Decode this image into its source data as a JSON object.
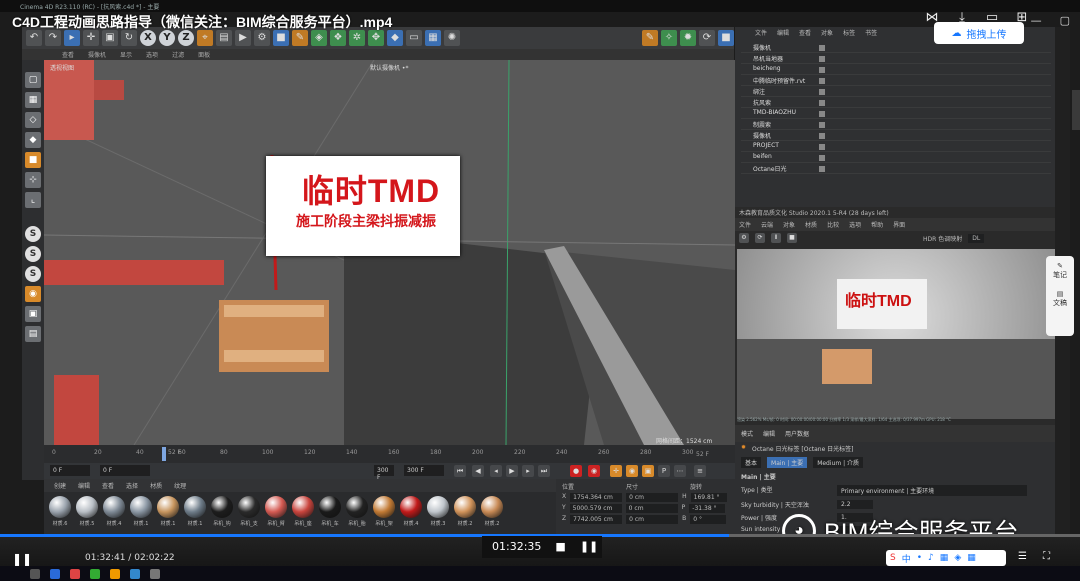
{
  "window": {
    "title": "Cinema 4D R23.110 (RC) - [抗风索.c4d *] - 主要"
  },
  "video": {
    "title": "C4D工程动画思路指导（微信关注：BIM综合服务平台）.mp4",
    "elapsed": "01:32:41",
    "total": "02:02:22",
    "time_sep": "/",
    "pause_time": "01:32:35",
    "progress": 0.675
  },
  "header_actions": {
    "upload_label": "拖拽上传"
  },
  "toolbar": {
    "axis_x": "X",
    "axis_y": "Y",
    "axis_z": "Z"
  },
  "viewport_menu": [
    "查看",
    "摄像机",
    "显示",
    "选项",
    "过滤",
    "面板"
  ],
  "viewport": {
    "label": "透视视图",
    "camera": "默认摄像机 •*",
    "grid_info": "网格间距：1524 cm"
  },
  "scene": {
    "sign_title": "临时TMD",
    "sign_subtitle": "施工阶段主梁抖振减振"
  },
  "timeline": {
    "ticks": [
      "0",
      "20",
      "40",
      "60",
      "80",
      "100",
      "120",
      "140",
      "160",
      "180",
      "200",
      "220",
      "240",
      "260",
      "280",
      "300"
    ],
    "marker": "52 F",
    "end": "52 F"
  },
  "playback": {
    "start": "0 F",
    "current": "0 F",
    "end1": "300 F",
    "end2": "300 F"
  },
  "material_menu": [
    "创建",
    "编辑",
    "查看",
    "选择",
    "材质",
    "纹理"
  ],
  "materials": [
    {
      "label": "材质.6",
      "color": "#9aa3ad"
    },
    {
      "label": "材质.5",
      "color": "#b8bec5"
    },
    {
      "label": "材质.4",
      "color": "#7f8a96"
    },
    {
      "label": "材质.1",
      "color": "#8a96a3"
    },
    {
      "label": "材质.1",
      "color": "#c7955e"
    },
    {
      "label": "材质.1",
      "color": "#6e7c89"
    },
    {
      "label": "吊机_钩",
      "color": "#1d1d1d"
    },
    {
      "label": "吊机_支",
      "color": "#2a2a2a"
    },
    {
      "label": "吊机_臂",
      "color": "#d45a52"
    },
    {
      "label": "吊机_座",
      "color": "#c9443d"
    },
    {
      "label": "吊机_车",
      "color": "#1a1a1a"
    },
    {
      "label": "吊机_胎",
      "color": "#222"
    },
    {
      "label": "吊机_架",
      "color": "#c27a34"
    },
    {
      "label": "材质.4",
      "color": "#c11a1a"
    },
    {
      "label": "材质.3",
      "color": "#bfc5cb"
    },
    {
      "label": "材质.2",
      "color": "#d1935a"
    },
    {
      "label": "材质.2",
      "color": "#c88a55"
    }
  ],
  "coords": {
    "headers": [
      "位置",
      "尺寸",
      "旋转"
    ],
    "rows": [
      {
        "axis": "X",
        "pos": "1754.364 cm",
        "size": "0 cm",
        "rot_l": "H",
        "rot": "169.81 °"
      },
      {
        "axis": "Y",
        "pos": "5000.579 cm",
        "size": "0 cm",
        "rot_l": "P",
        "rot": "-31.38 °"
      },
      {
        "axis": "Z",
        "pos": "7742.005 cm",
        "size": "0 cm",
        "rot_l": "B",
        "rot": "0 °"
      }
    ]
  },
  "object_menu": [
    "文件",
    "编辑",
    "查看",
    "对象",
    "标签",
    "书签"
  ],
  "objects": [
    "摄像机",
    "吊机当地器",
    "beicheng",
    "中腾临时预留件.rvt",
    "绑注",
    "抗风索",
    "TMD-BIAOZHU",
    "制震索",
    "摄像机",
    "PROJECT",
    "beifen",
    "Octane日光"
  ],
  "render": {
    "title": "木森教育品质文化 Studio 2020.1 5-R4 (28 days left)",
    "menu": [
      "文件",
      "云端",
      "对象",
      "材质",
      "比较",
      "选项",
      "帮助",
      "界面"
    ],
    "hdr": "HDR 色调映射",
    "dl": "DL",
    "sign_text": "临时TMD",
    "status": "渲染 2.562%   Ms/帧: 0   时间: 00:00:00/00:00:00   分辨率 1/3   采样/最大采样: 1/64   主选项: 0/37.997m   GPU: 218 °C"
  },
  "attr": {
    "menu": [
      "模式",
      "编辑",
      "用户数据"
    ],
    "object": "Octane 日光标签 [Octane 日光标签]",
    "tabs": [
      "基本",
      "Main | 主要",
      "Medium | 介质"
    ],
    "section": "Main | 主要",
    "rows": [
      {
        "label": "Type | 类型",
        "value": "Primary environment | 主要环境"
      },
      {
        "label": "Sky turbidity | 天空浑浊",
        "value": "2.2"
      },
      {
        "label": "Power | 强度",
        "value": "1."
      },
      {
        "label": "Sun intensity",
        "value": ""
      }
    ]
  },
  "sidetool": {
    "note": "笔记",
    "doc": "文稿"
  },
  "watermark": {
    "text": "BIM综合服务平台"
  }
}
